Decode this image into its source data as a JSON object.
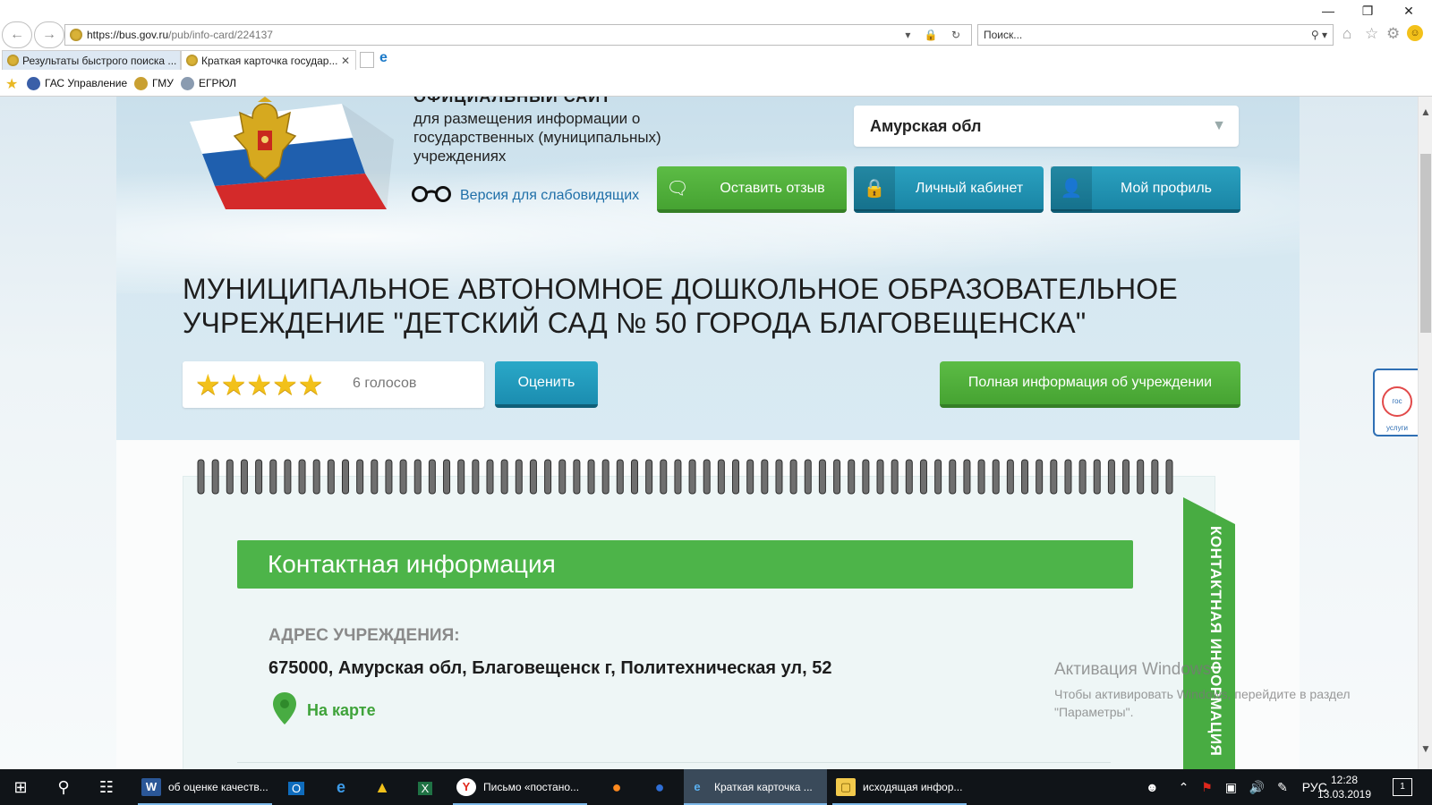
{
  "browser": {
    "url_domain": "https://bus.gov.ru",
    "url_path": "/pub/info-card/224137",
    "search_placeholder": "Поиск...",
    "tabs": [
      {
        "label": "Результаты быстрого поиска ..."
      },
      {
        "label": "Краткая карточка государ..."
      }
    ],
    "favorites": [
      "ГАС Управление",
      "ГМУ",
      "ЕГРЮЛ"
    ],
    "window_controls": {
      "minimize": "—",
      "restore": "❐",
      "close": "✕"
    }
  },
  "header": {
    "site_title": "ОФИЦИАЛЬНЫЙ САЙТ",
    "site_description": "для размещения информации о государственных (муниципальных) учреждениях",
    "region": "Амурская обл",
    "low_vision_label": "Версия для слабовидящих",
    "buttons": {
      "feedback": "Оставить отзыв",
      "cabinet": "Личный кабинет",
      "profile": "Мой профиль"
    }
  },
  "organization": {
    "name": "МУНИЦИПАЛЬНОЕ АВТОНОМНОЕ ДОШКОЛЬНОЕ ОБРАЗОВАТЕЛЬНОЕ УЧРЕЖДЕНИЕ \"ДЕТСКИЙ САД № 50 ГОРОДА БЛАГОВЕЩЕНСКА\"",
    "rating_stars": 5,
    "rating_max": 5,
    "votes_label": "6 голосов",
    "rate_button": "Оценить",
    "full_info_button": "Полная информация об учреждении"
  },
  "contact": {
    "section_title": "Контактная информация",
    "side_tab_label": "КОНТАКТНАЯ ИНФОРМАЦИЯ",
    "address_label": "АДРЕС УЧРЕЖДЕНИЯ:",
    "address_value": "675000, Амурская обл, Благовещенск г, Политехническая ул, 52",
    "map_link": "На карте"
  },
  "gosuslugi_badge": "гос услуги",
  "windows_activation": {
    "title": "Активация Windows",
    "text": "Чтобы активировать Windows, перейдите в раздел \"Параметры\"."
  },
  "taskbar": {
    "apps": [
      {
        "label": "об оценке качеств...",
        "icon": "word-icon"
      },
      {
        "label": "Письмо «постано...",
        "icon": "yandex-browser-icon"
      },
      {
        "label": "Краткая карточка ...",
        "icon": "internet-explorer-icon"
      },
      {
        "label": "исходящая инфор...",
        "icon": "file-explorer-icon"
      }
    ],
    "language": "РУС",
    "time": "12:28",
    "date": "13.03.2019",
    "notification_count": "1"
  },
  "colors": {
    "accent_green": "#4db449",
    "accent_teal": "#1f95b6",
    "link_blue": "#1f6fa8",
    "star_yellow": "#f2c11a"
  }
}
